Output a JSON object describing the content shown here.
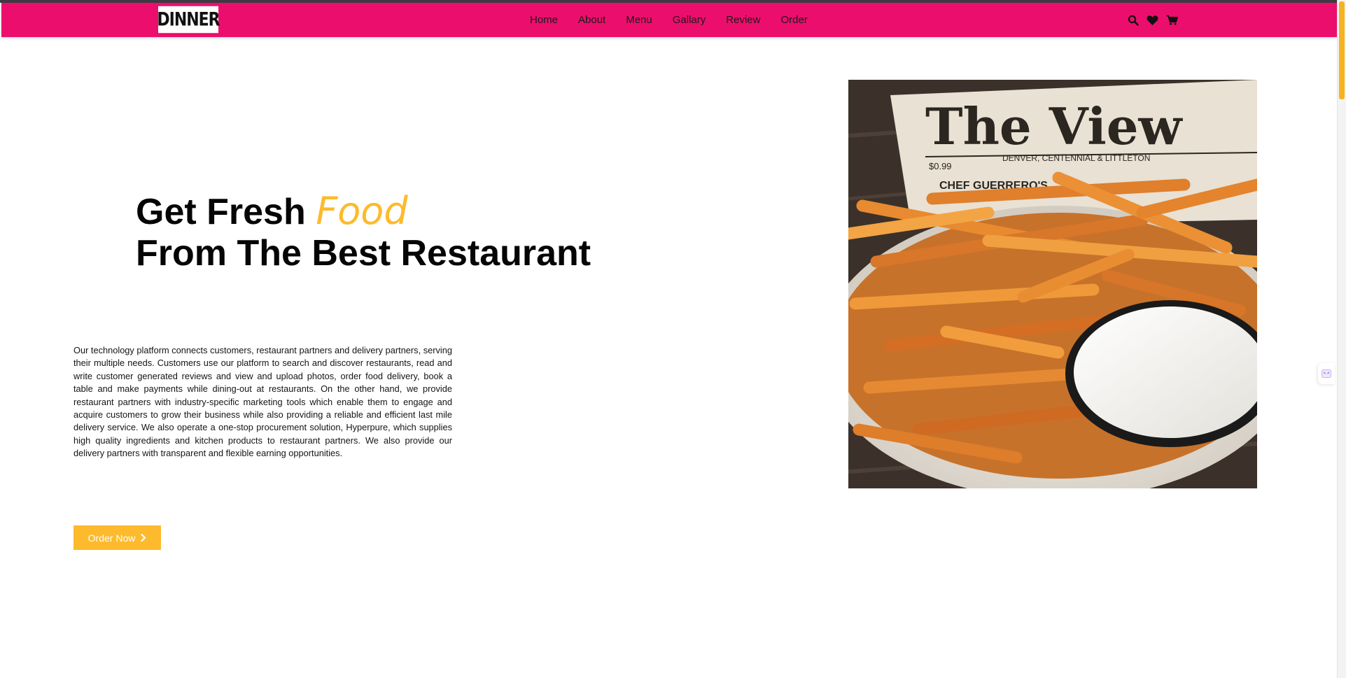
{
  "brand": {
    "logo_text": "DINNER"
  },
  "nav": {
    "items": [
      "Home",
      "About",
      "Menu",
      "Gallary",
      "Review",
      "Order"
    ]
  },
  "icons": {
    "search": "search-icon",
    "heart": "heart-icon",
    "cart": "cart-icon"
  },
  "hero": {
    "title_line1_prefix": "Get Fresh",
    "title_line1_accent": "Food",
    "title_line2": "From The Best Restaurant",
    "description": "Our technology platform connects customers, restaurant partners and delivery partners, serving their multiple needs. Customers use our platform to search and discover restaurants, read and write customer generated reviews and view and upload photos, order food delivery, book a table and make payments while dining-out at restaurants. On the other hand, we provide restaurant partners with industry-specific marketing tools which enable them to engage and acquire customers to grow their business while also providing a reliable and efficient last mile delivery service. We also operate a one-stop procurement solution, Hyperpure, which supplies high quality ingredients and kitchen products to restaurant partners. We also provide our delivery partners with transparent and flexible earning opportunities.",
    "button_label": "Order Now",
    "image_newspaper_title": "The View",
    "image_newspaper_price": "$0.99",
    "image_newspaper_place": "DENVER, CENTENNIAL & LITTLETON",
    "image_newspaper_headline": "CHEF GUERRERO'S"
  },
  "colors": {
    "nav_bg": "#ec0e6c",
    "accent": "#fdba2c",
    "text": "#050505"
  }
}
